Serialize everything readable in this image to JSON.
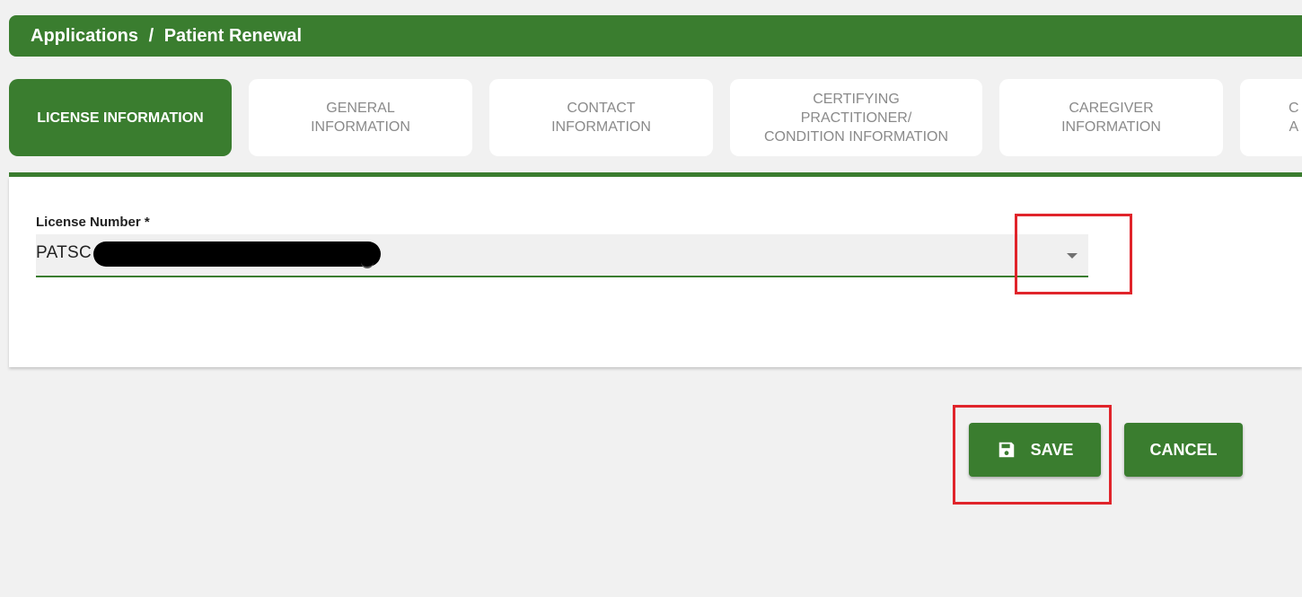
{
  "header": {
    "section": "Applications",
    "separator": "/",
    "page": "Patient Renewal"
  },
  "tabs": [
    {
      "label": "LICENSE INFORMATION",
      "active": true
    },
    {
      "label": "GENERAL\nINFORMATION",
      "active": false
    },
    {
      "label": "CONTACT\nINFORMATION",
      "active": false
    },
    {
      "label": "CERTIFYING\nPRACTITIONER/\nCONDITION INFORMATION",
      "active": false
    },
    {
      "label": "CAREGIVER\nINFORMATION",
      "active": false
    },
    {
      "label": "C\nA",
      "active": false
    }
  ],
  "form": {
    "license_label": "License Number *",
    "license_value": "PATSC"
  },
  "buttons": {
    "save_label": "SAVE",
    "cancel_label": "CANCEL"
  },
  "colors": {
    "brand_green": "#3a7d2f",
    "highlight_red": "#e0242b",
    "background": "#f1f1f1"
  },
  "icons": {
    "save": "floppy-disk-icon",
    "dropdown": "caret-down-icon"
  }
}
